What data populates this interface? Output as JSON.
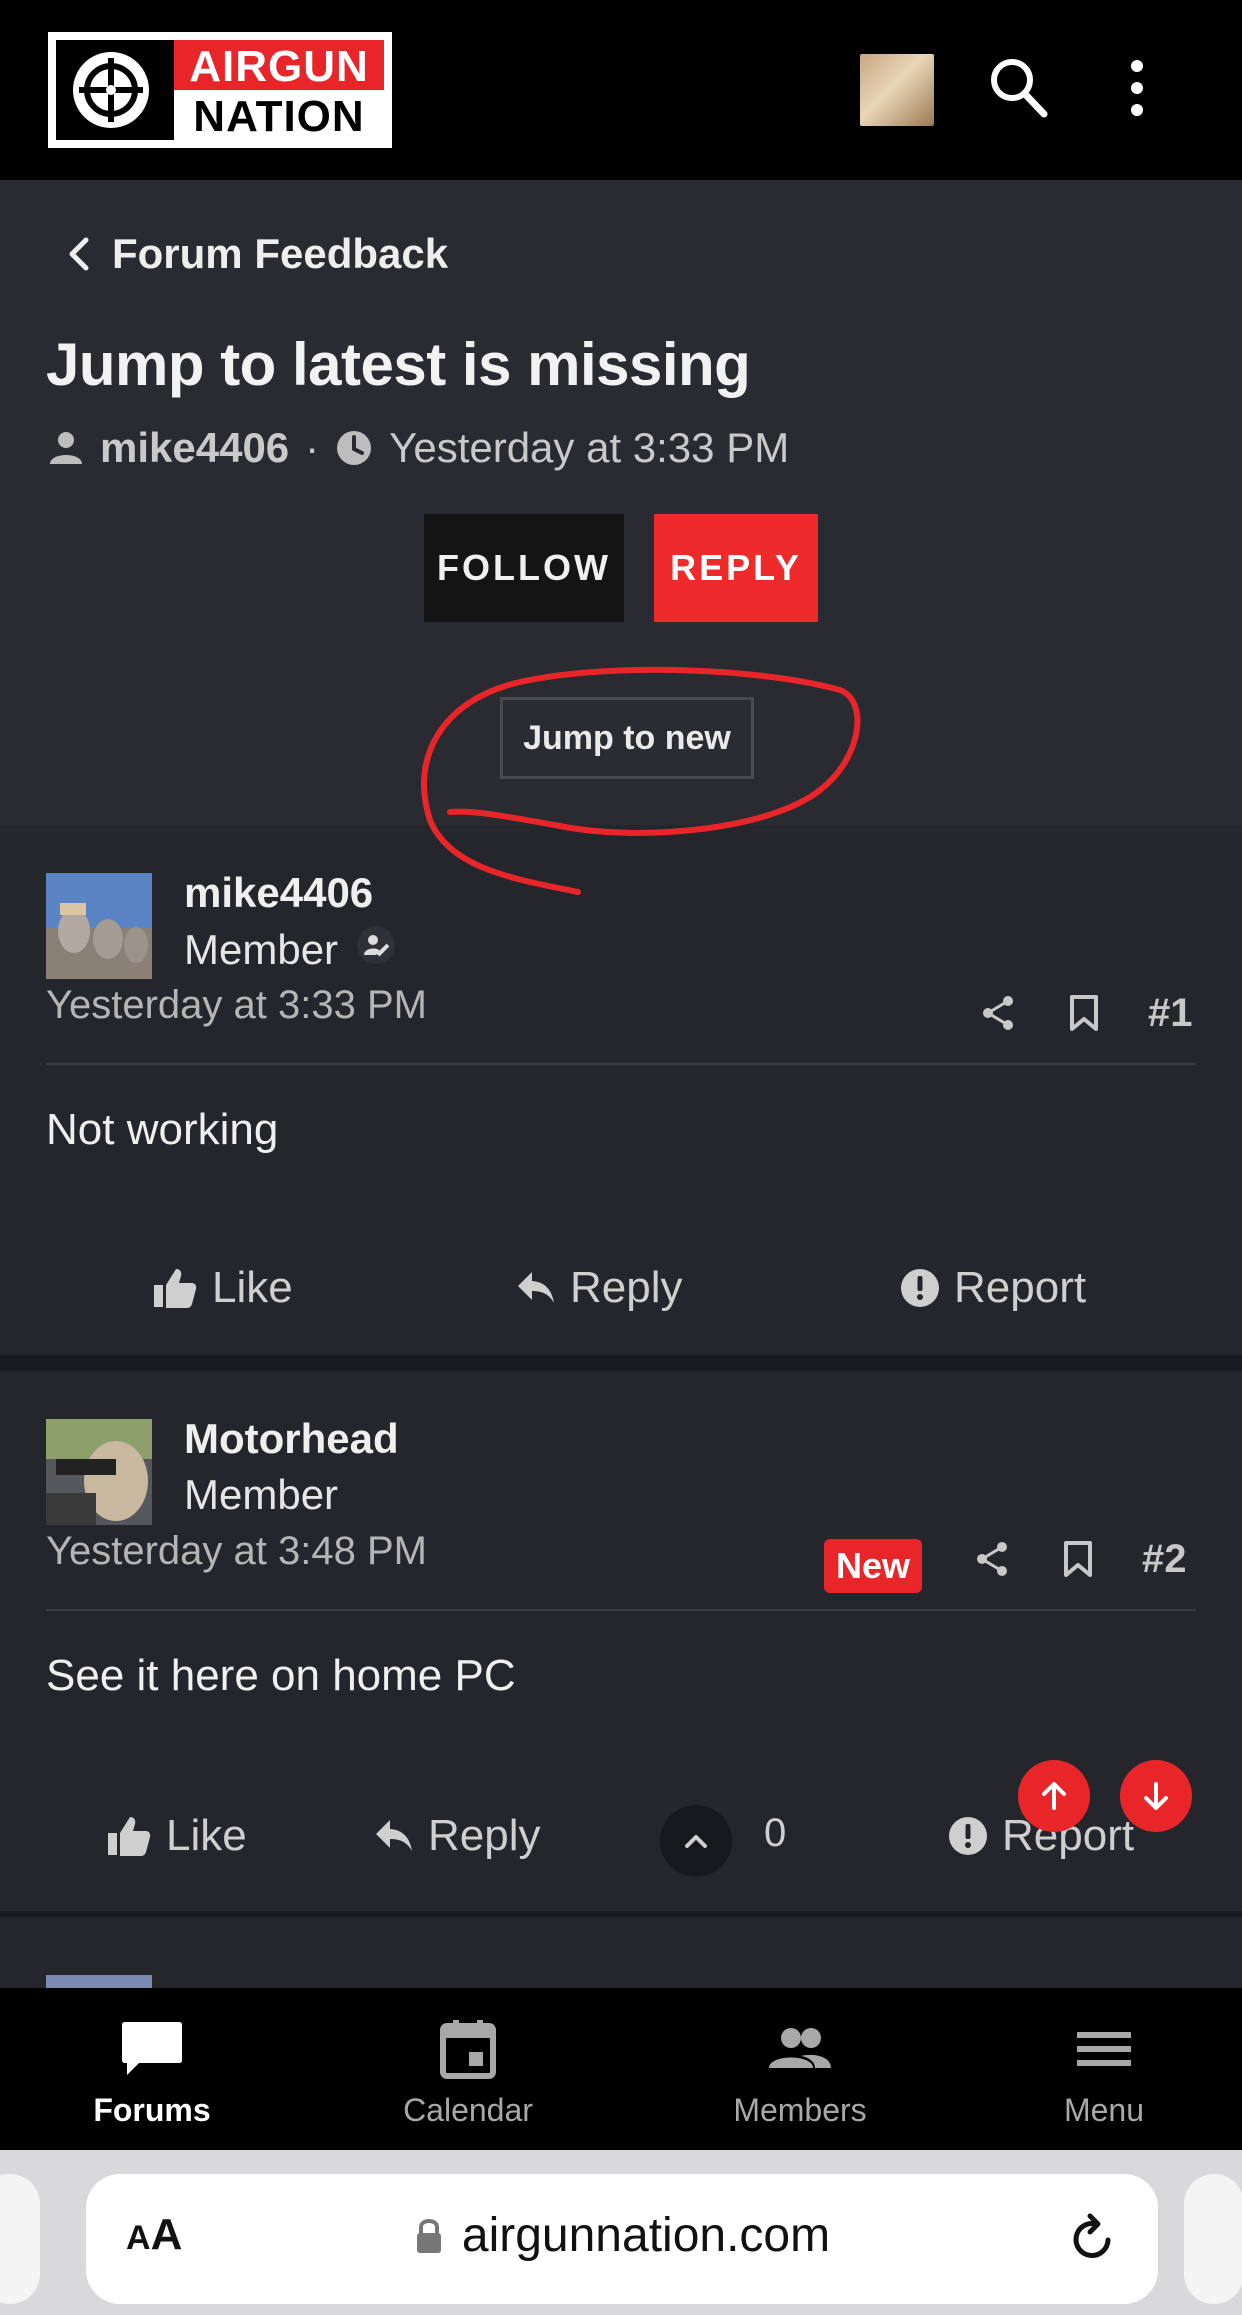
{
  "colors": {
    "brand_red": "#e82629",
    "page_bg": "#24252a",
    "header_bg": "#000000"
  },
  "logo": {
    "line1": "AIRGUN",
    "line2": "NATION"
  },
  "header": {
    "icons": [
      "crosshair-icon",
      "user-avatar",
      "search-icon",
      "more-vertical-icon"
    ]
  },
  "thread": {
    "back_label": "Forum Feedback",
    "title": "Jump to latest is missing",
    "author": "mike4406",
    "separator": "·",
    "time": "Yesterday at 3:33 PM",
    "follow_label": "FOLLOW",
    "reply_label": "REPLY",
    "jump_label": "Jump to new"
  },
  "posts": [
    {
      "username": "mike4406",
      "role": "Member",
      "time": "Yesterday at 3:33 PM",
      "number": "#1",
      "body": "Not working",
      "like": "Like",
      "reply": "Reply",
      "report": "Report"
    },
    {
      "username": "Motorhead",
      "role": "Member",
      "time": "Yesterday at 3:48 PM",
      "badge": "New",
      "number": "#2",
      "body": "See it here on home PC",
      "like": "Like",
      "reply": "Reply",
      "score": "0",
      "report": "Report"
    }
  ],
  "bottom_nav": [
    {
      "label": "Forums",
      "icon": "chat-bubble-icon",
      "active": true
    },
    {
      "label": "Calendar",
      "icon": "calendar-icon",
      "active": false
    },
    {
      "label": "Members",
      "icon": "members-icon",
      "active": false
    },
    {
      "label": "Menu",
      "icon": "hamburger-icon",
      "active": false
    }
  ],
  "browser": {
    "aa_label_big": "A",
    "aa_label_small": "A",
    "url": "airgunnation.com"
  }
}
